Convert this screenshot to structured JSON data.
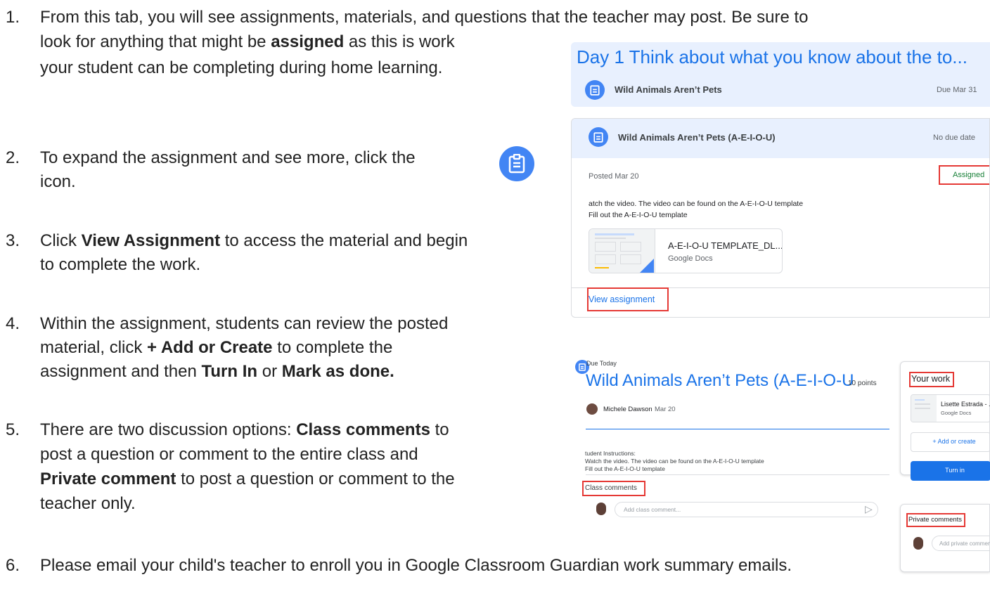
{
  "instructions": {
    "item1": {
      "num": "1.",
      "l1": "From this tab, you will see assignments, materials, and questions that the teacher may post. Be sure to",
      "l2a": "look for anything that might be ",
      "l2b": "assigned",
      "l2c": " as this is work",
      "l3": "your student can be completing during home learning."
    },
    "item2": {
      "num": "2.",
      "l1": "To expand the assignment and see more, click the",
      "l2": "icon."
    },
    "item3": {
      "num": "3.",
      "l1a": "Click ",
      "l1b": "View Assignment",
      "l1c": " to access the material and begin",
      "l2": "to complete the work."
    },
    "item4": {
      "num": "4.",
      "l1": "Within the assignment, students can review the posted",
      "l2a": "material, click ",
      "l2b": "+ Add or Create",
      "l2c": " to complete the",
      "l3a": "assignment and then ",
      "l3b": "Turn In",
      "l3c": " or ",
      "l3d": "Mark as done."
    },
    "item5": {
      "num": "5.",
      "l1a": "There are two discussion options: ",
      "l1b": "Class comments",
      "l1c": " to",
      "l2": "post a question or comment to the entire class and",
      "l3a": "Private comment",
      "l3b": " to post a question or comment to the",
      "l4": "teacher only."
    },
    "item6": {
      "num": "6.",
      "l1": "Please email your child's teacher to enroll you in Google Classroom Guardian work summary emails."
    }
  },
  "screenshot1": {
    "topic_title": "Day 1 Think about what you know about the to...",
    "item1": {
      "title": "Wild Animals Aren’t Pets",
      "due": "Due Mar 31"
    },
    "item2": {
      "title": "Wild Animals Aren’t Pets (A-E-I-O-U)",
      "due": "No due date"
    },
    "posted": "Posted Mar 20",
    "status": "Assigned",
    "desc1": "atch the video. The video can be found on the A-E-I-O-U template",
    "desc2": "Fill out the A-E-I-O-U template",
    "attachment": {
      "title": "A-E-I-O-U TEMPLATE_DL...",
      "type": "Google Docs"
    },
    "view_link": "View assignment"
  },
  "screenshot2": {
    "due": "Due Today",
    "title": "Wild Animals Aren’t Pets (A-E-I-O-U",
    "points": "10 points",
    "author": "Michele Dawson",
    "date": "Mar 20",
    "instr1": "tudent Instructions:",
    "instr2": "Watch the video. The video can be found on the A-E-I-O-U template",
    "instr3": "Fill out the A-E-I-O-U template",
    "class_comments": "Class comments",
    "class_comment_placeholder": "Add class comment...",
    "your_work": "Your work",
    "work_file": "Lisette Estrada - ...",
    "work_file_type": "Google Docs",
    "add_or_create": "+ Add or create",
    "turn_in": "Turn in",
    "private_comments": "Private comments",
    "private_placeholder": "Add private comment..."
  }
}
